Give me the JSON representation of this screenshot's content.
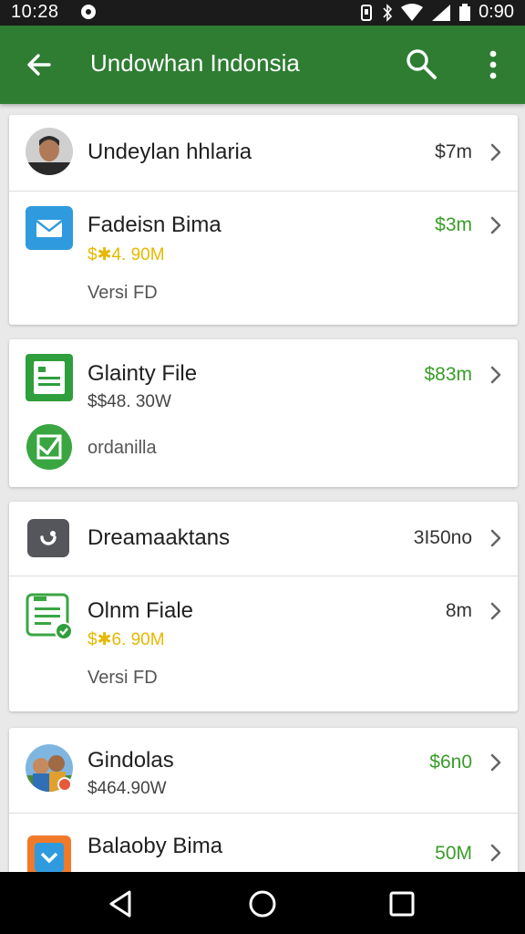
{
  "status_bar": {
    "time": "10:28",
    "battery_text": "0:90",
    "icons": [
      "notification-icon",
      "vibrate-icon",
      "bluetooth-icon",
      "wifi-icon",
      "signal-icon",
      "battery-icon"
    ]
  },
  "app_bar": {
    "title": "Undowhan Indonsia",
    "icons": [
      "back-arrow-icon",
      "search-icon",
      "more-vert-icon"
    ]
  },
  "colors": {
    "app_bar": "#2e7d32",
    "green_amount": "#3a9c2a",
    "gold_sub": "#e6b800"
  },
  "cards": [
    {
      "rows": [
        {
          "name": "Undeylan hhlaria",
          "amount": "$7m",
          "icon": "avatar-photo"
        },
        {
          "name": "Fadeisn Bima",
          "sub": "$✱4. 90M",
          "note": "Versi FD",
          "amount": "$3m",
          "icon": "mail-icon"
        }
      ]
    },
    {
      "rows": [
        {
          "name": "Glainty File",
          "sub": "$$48. 30W",
          "amount": "$83m",
          "icon": "form-doc-icon"
        },
        {
          "note": "ordanilla",
          "icon": "check-badge-icon"
        }
      ]
    },
    {
      "rows": [
        {
          "name": "Dreamaaktans",
          "amount": "3I50no",
          "icon": "dark-rounded-icon"
        },
        {
          "name": "Olnm Fiale",
          "sub": "$✱6. 90M",
          "note": "Versi FD",
          "amount": "8m",
          "icon": "doc-check-icon"
        }
      ]
    },
    {
      "rows": [
        {
          "name": "Gindolas",
          "sub": "$464.90W",
          "amount": "$6n0",
          "icon": "group-photo"
        },
        {
          "name": "Balaoby Bima",
          "amount": "50M",
          "icon": "shield-app-icon"
        }
      ]
    }
  ],
  "nav_bar": {
    "icons": [
      "nav-back-icon",
      "nav-home-icon",
      "nav-recents-icon"
    ]
  }
}
